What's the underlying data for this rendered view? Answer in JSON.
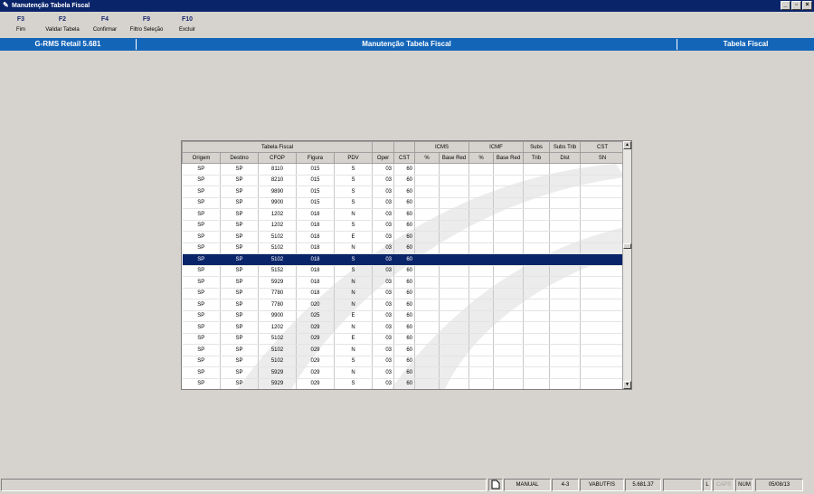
{
  "window": {
    "title": "Manutenção Tabela Fiscal",
    "controls": [
      "_",
      "▫",
      "×"
    ]
  },
  "toolbar": [
    {
      "key": "F3",
      "label": "Fim"
    },
    {
      "key": "F2",
      "label": "Validar Tabela"
    },
    {
      "key": "F4",
      "label": "Confirmar"
    },
    {
      "key": "F9",
      "label": "Filtro Seleção"
    },
    {
      "key": "F10",
      "label": "Excluir"
    }
  ],
  "header": {
    "app": "G-RMS Retail 5.681",
    "screen": "Manutenção Tabela Fiscal",
    "module": "Tabela Fiscal"
  },
  "grid": {
    "group_headers": [
      "Tabela Fiscal",
      "",
      "",
      "ICMS",
      "ICMF",
      "Subs",
      "Subs Trib",
      "CST"
    ],
    "columns": [
      "Origem",
      "Destino",
      "CFOP",
      "Figura",
      "PDV",
      "Oper",
      "CST",
      "%",
      "Base Red",
      "%",
      "Base Red",
      "Trib",
      "Dist",
      "SN"
    ],
    "selected_index": 8,
    "rows": [
      [
        "SP",
        "SP",
        "8110",
        "015",
        "S",
        "03",
        "60"
      ],
      [
        "SP",
        "SP",
        "8210",
        "015",
        "S",
        "03",
        "60"
      ],
      [
        "SP",
        "SP",
        "9890",
        "015",
        "S",
        "03",
        "60"
      ],
      [
        "SP",
        "SP",
        "9900",
        "015",
        "S",
        "03",
        "60"
      ],
      [
        "SP",
        "SP",
        "1202",
        "018",
        "N",
        "03",
        "60"
      ],
      [
        "SP",
        "SP",
        "1202",
        "018",
        "S",
        "03",
        "60"
      ],
      [
        "SP",
        "SP",
        "5102",
        "018",
        "E",
        "03",
        "60"
      ],
      [
        "SP",
        "SP",
        "5102",
        "018",
        "N",
        "03",
        "60"
      ],
      [
        "SP",
        "SP",
        "5102",
        "018",
        "S",
        "03",
        "60"
      ],
      [
        "SP",
        "SP",
        "5152",
        "018",
        "S",
        "03",
        "60"
      ],
      [
        "SP",
        "SP",
        "5929",
        "018",
        "N",
        "03",
        "60"
      ],
      [
        "SP",
        "SP",
        "7780",
        "018",
        "N",
        "03",
        "60"
      ],
      [
        "SP",
        "SP",
        "7780",
        "020",
        "N",
        "03",
        "60"
      ],
      [
        "SP",
        "SP",
        "9900",
        "025",
        "E",
        "03",
        "60"
      ],
      [
        "SP",
        "SP",
        "1202",
        "029",
        "N",
        "03",
        "60"
      ],
      [
        "SP",
        "SP",
        "5102",
        "029",
        "E",
        "03",
        "60"
      ],
      [
        "SP",
        "SP",
        "5102",
        "029",
        "N",
        "03",
        "60"
      ],
      [
        "SP",
        "SP",
        "5102",
        "029",
        "S",
        "03",
        "60"
      ],
      [
        "SP",
        "SP",
        "5929",
        "029",
        "N",
        "03",
        "60"
      ],
      [
        "SP",
        "SP",
        "5929",
        "029",
        "S",
        "03",
        "60"
      ]
    ]
  },
  "statusbar": {
    "mode": "MANUAL",
    "version_code": "4-3",
    "user": "VABUTFIS",
    "version": "5.681.37",
    "l": "L",
    "caps": "CAPS",
    "num": "NUM",
    "date": "05/08/13"
  },
  "colors": {
    "title_bar": "#0a246a",
    "header_bar": "#1365b8",
    "selected_row": "#0a246a",
    "background": "#d6d3ce"
  }
}
